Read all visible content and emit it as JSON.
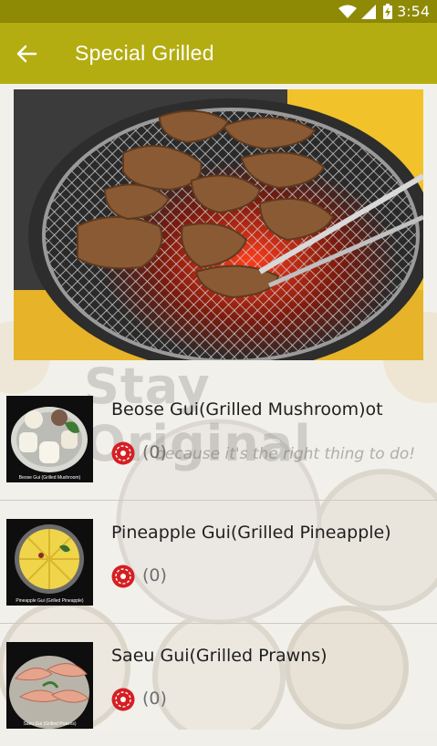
{
  "status": {
    "time": "3:54"
  },
  "header": {
    "title": "Special Grilled"
  },
  "background": {
    "watermark_title": "Stay Original",
    "watermark_tagline": "because it's the right thing to do!"
  },
  "items": [
    {
      "name": "Beose Gui(Grilled Mushroom)ot",
      "rating": "(0)",
      "thumb_caption": "Beose Gui (Grilled Mushroom)"
    },
    {
      "name": "Pineapple Gui(Grilled Pineapple)",
      "rating": "(0)",
      "thumb_caption": "Pineapple Gui (Grilled Pineapple)"
    },
    {
      "name": "Saeu Gui(Grilled Prawns)",
      "rating": "(0)",
      "thumb_caption": "Saeu Gui (Grilled Prawns)"
    }
  ],
  "colors": {
    "appbar": "#b3ad12",
    "statusbar": "#8e8a06",
    "rating_icon": "#d51f23"
  }
}
